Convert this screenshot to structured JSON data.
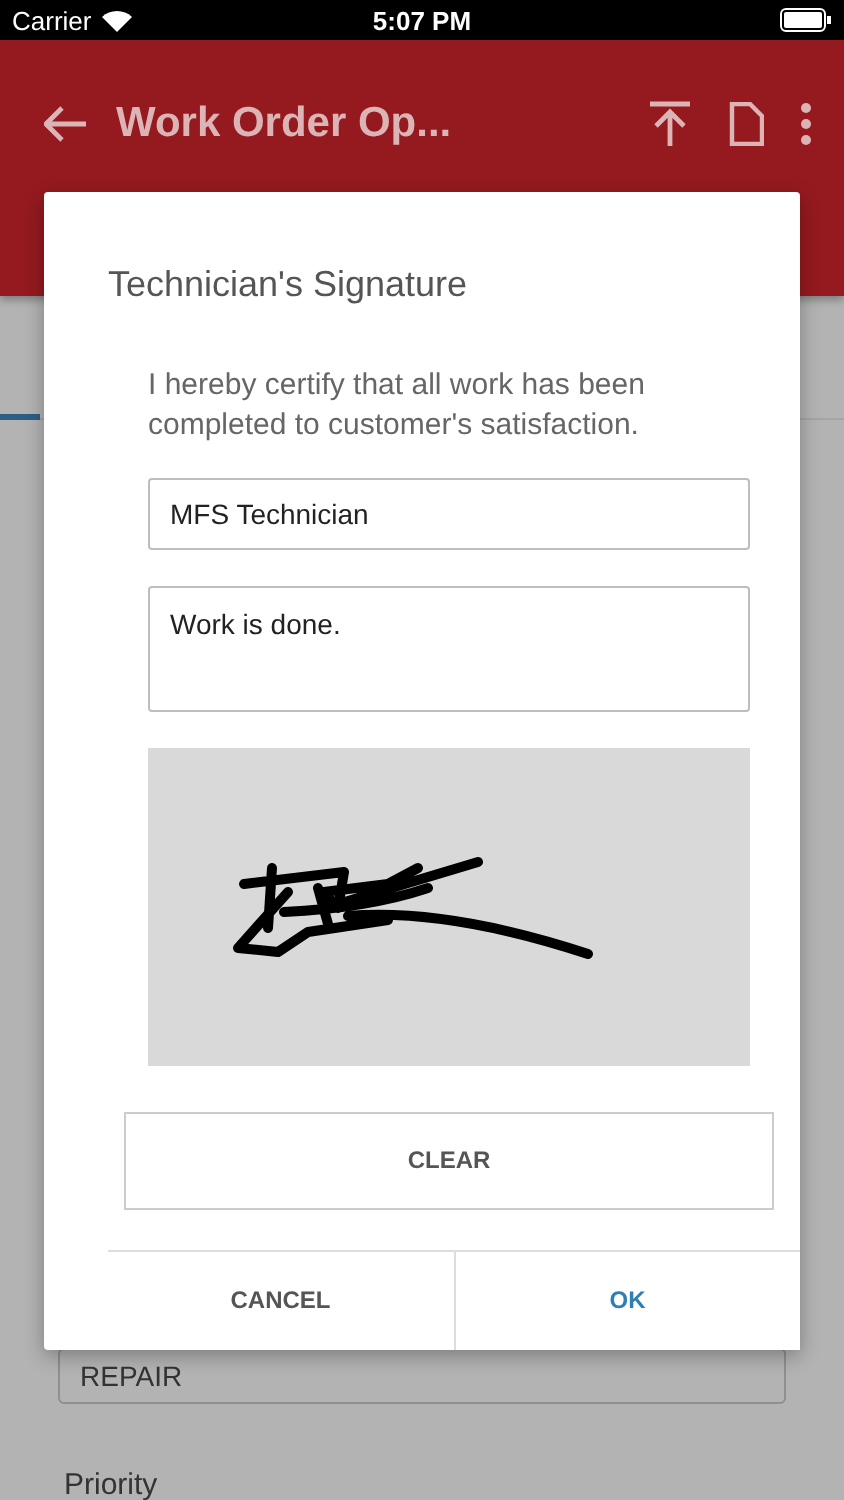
{
  "status_bar": {
    "carrier": "Carrier",
    "time": "5:07 PM"
  },
  "header": {
    "title": "Work Order Op..."
  },
  "form": {
    "type_value": "REPAIR",
    "priority_label": "Priority"
  },
  "dialog": {
    "title": "Technician's Signature",
    "statement": "I hereby certify that all work has been completed to customer's satisfaction.",
    "name_value": "MFS Technician",
    "notes_value": "Work is done.",
    "clear": "CLEAR",
    "cancel": "CANCEL",
    "ok": "OK"
  }
}
